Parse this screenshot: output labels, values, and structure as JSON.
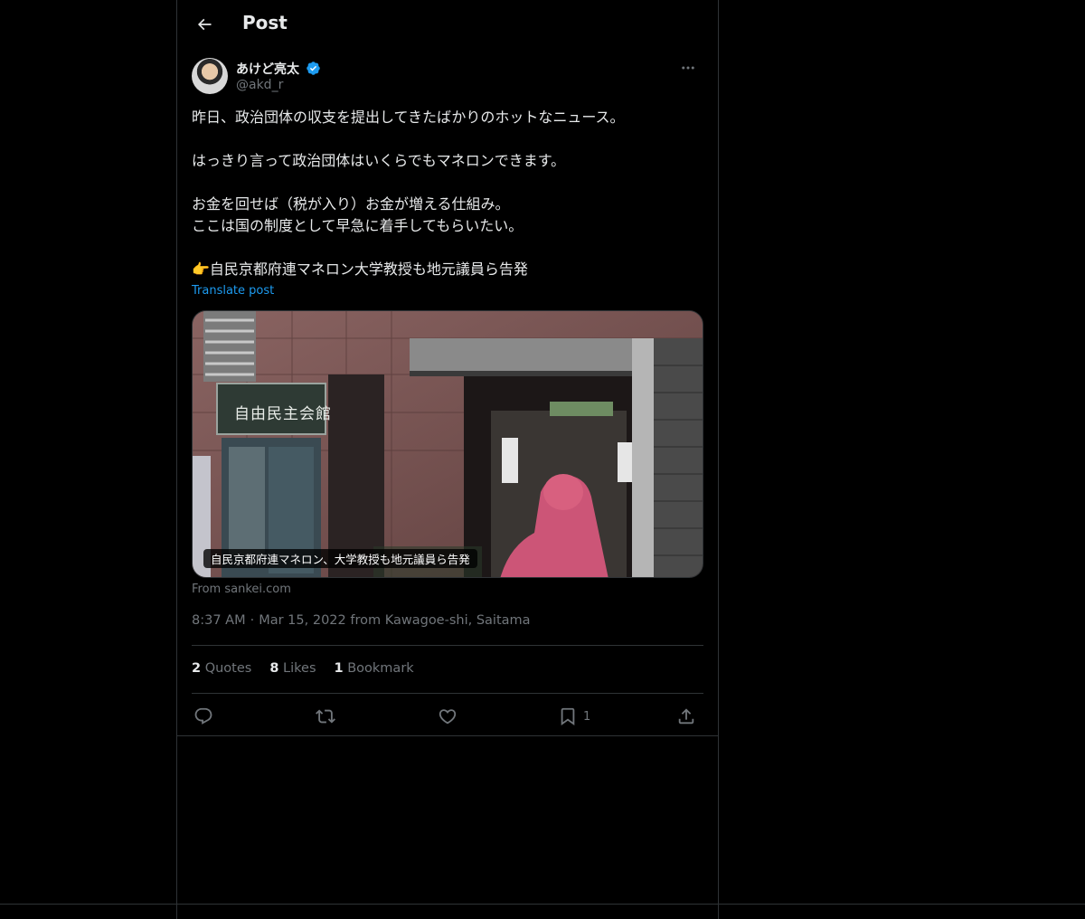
{
  "header": {
    "title": "Post"
  },
  "author": {
    "display_name": "あけど亮太",
    "handle": "@akd_r"
  },
  "post": {
    "text": "昨日、政治団体の収支を提出してきたばかりのホットなニュース。\n\nはっきり言って政治団体はいくらでもマネロンできます。\n\nお金を回せば（税が入り）お金が増える仕組み。\nここは国の制度として早急に着手してもらいたい。\n\n👉自民京都府連マネロン大学教授も地元議員ら告発",
    "translate_label": "Translate post"
  },
  "card": {
    "caption": "自民京都府連マネロン、大学教授も地元議員ら告発",
    "source": "From sankei.com",
    "sign_text": "自由民主会館"
  },
  "meta": {
    "time": "8:37 AM",
    "date": "Mar 15, 2022",
    "from_label": "from Kawagoe-shi, Saitama"
  },
  "stats": {
    "quotes_count": "2",
    "quotes_label": "Quotes",
    "likes_count": "8",
    "likes_label": "Likes",
    "bookmarks_count": "1",
    "bookmarks_label": "Bookmark"
  },
  "actions": {
    "bookmark_count": "1"
  },
  "colors": {
    "background": "#000000",
    "text": "#e7e9ea",
    "secondary": "#71767b",
    "accent": "#1d9bf0",
    "border": "#2f3336"
  },
  "icons": [
    "back-arrow-icon",
    "verified-badge-icon",
    "more-icon",
    "reply-icon",
    "repost-icon",
    "like-icon",
    "bookmark-icon",
    "share-icon"
  ]
}
